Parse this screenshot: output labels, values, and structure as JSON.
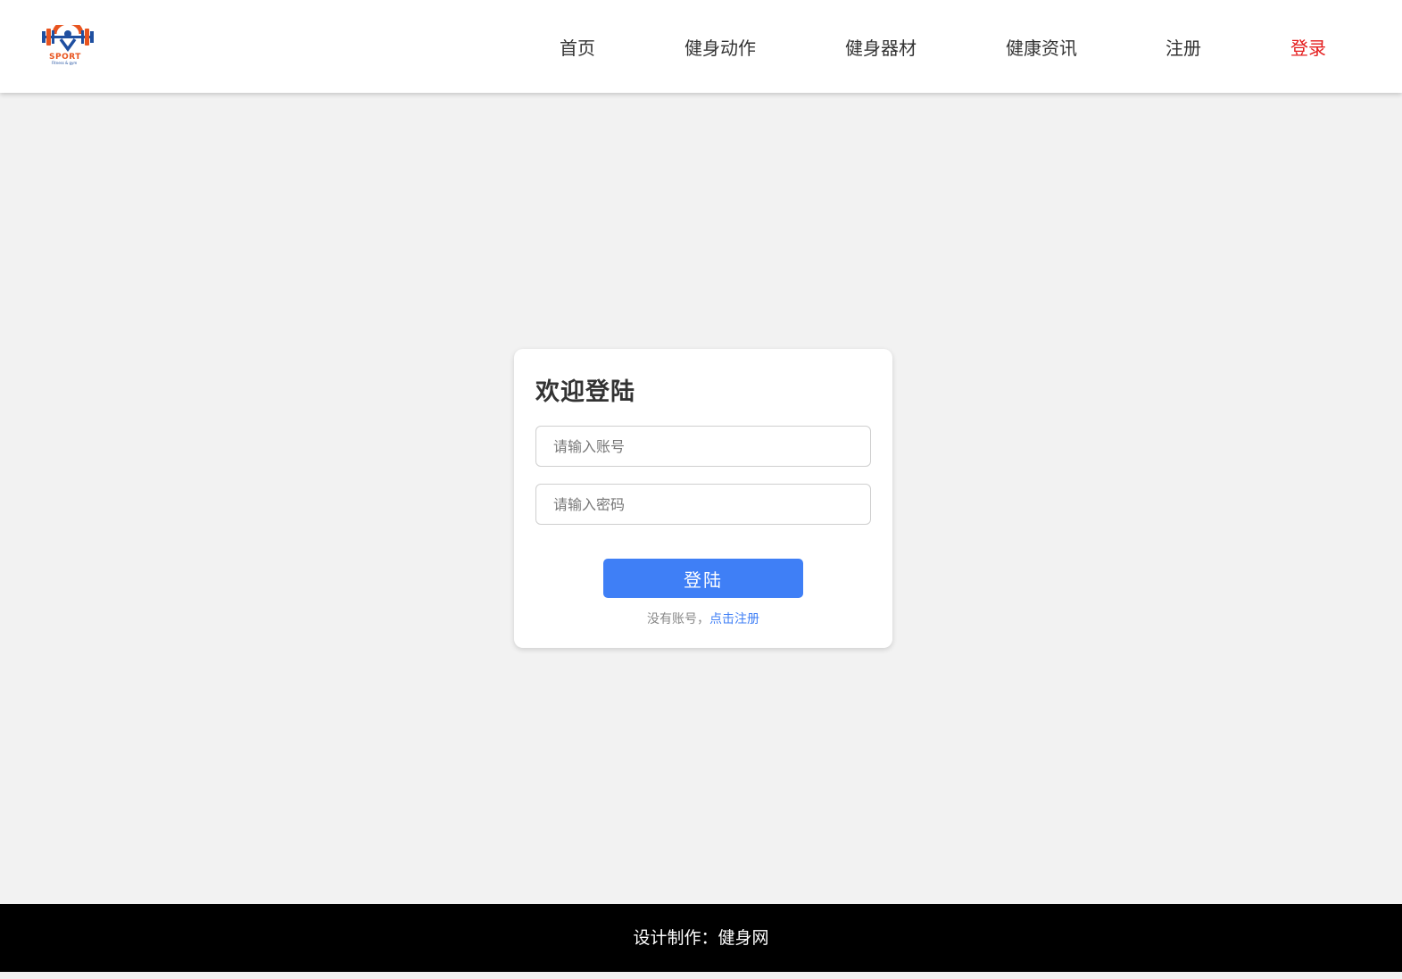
{
  "header": {
    "logo": {
      "text_main": "SPORT",
      "text_sub": "Fitness & gym",
      "colors": {
        "orange": "#e8541f",
        "blue": "#1f4fa0"
      }
    },
    "nav": [
      {
        "label": "首页"
      },
      {
        "label": "健身动作"
      },
      {
        "label": "健身器材"
      },
      {
        "label": "健康资讯"
      },
      {
        "label": "注册"
      },
      {
        "label": "登录",
        "active": true
      }
    ]
  },
  "login": {
    "title": "欢迎登陆",
    "account_placeholder": "请输入账号",
    "account_value": "",
    "password_placeholder": "请输入密码",
    "password_value": "",
    "submit_label": "登陆",
    "register_prompt": "没有账号，",
    "register_link": "点击注册"
  },
  "footer": {
    "text": "设计制作：健身网"
  },
  "colors": {
    "background": "#f2f2f2",
    "primary": "#3f7ff6",
    "nav_active": "#e41c1c",
    "footer_bg": "#000000"
  }
}
